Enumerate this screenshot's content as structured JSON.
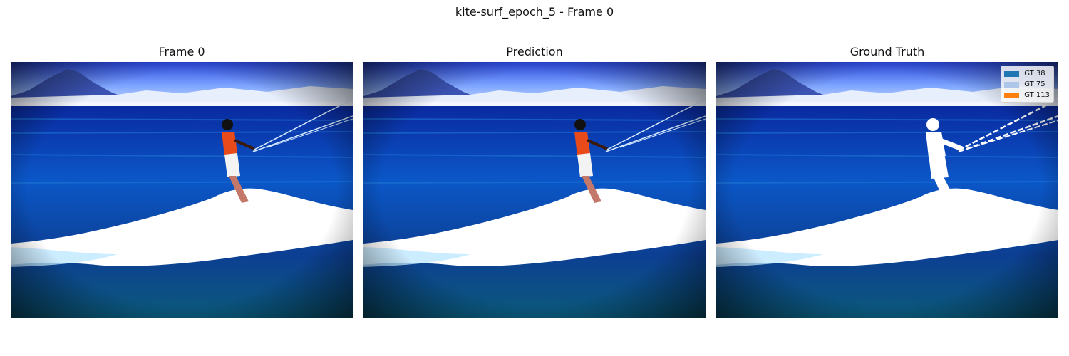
{
  "figure": {
    "suptitle": "kite-surf_epoch_5 - Frame 0",
    "panels": [
      {
        "title": "Frame 0"
      },
      {
        "title": "Prediction"
      },
      {
        "title": "Ground Truth"
      }
    ],
    "legend": {
      "items": [
        {
          "label": "GT 38",
          "color": "#1f77b4"
        },
        {
          "label": "GT 75",
          "color": "#aec7e8"
        },
        {
          "label": "GT 113",
          "color": "#ff7f0e"
        }
      ]
    }
  },
  "colors": {
    "sky": "#9fc2ff",
    "mountain": "#3c54b0",
    "sea_deep": "#06228a",
    "sea_mid": "#0a4fc0",
    "foam": "#ffffff",
    "surfer_shirt": "#e84a1a",
    "mask": "#ffffff"
  }
}
